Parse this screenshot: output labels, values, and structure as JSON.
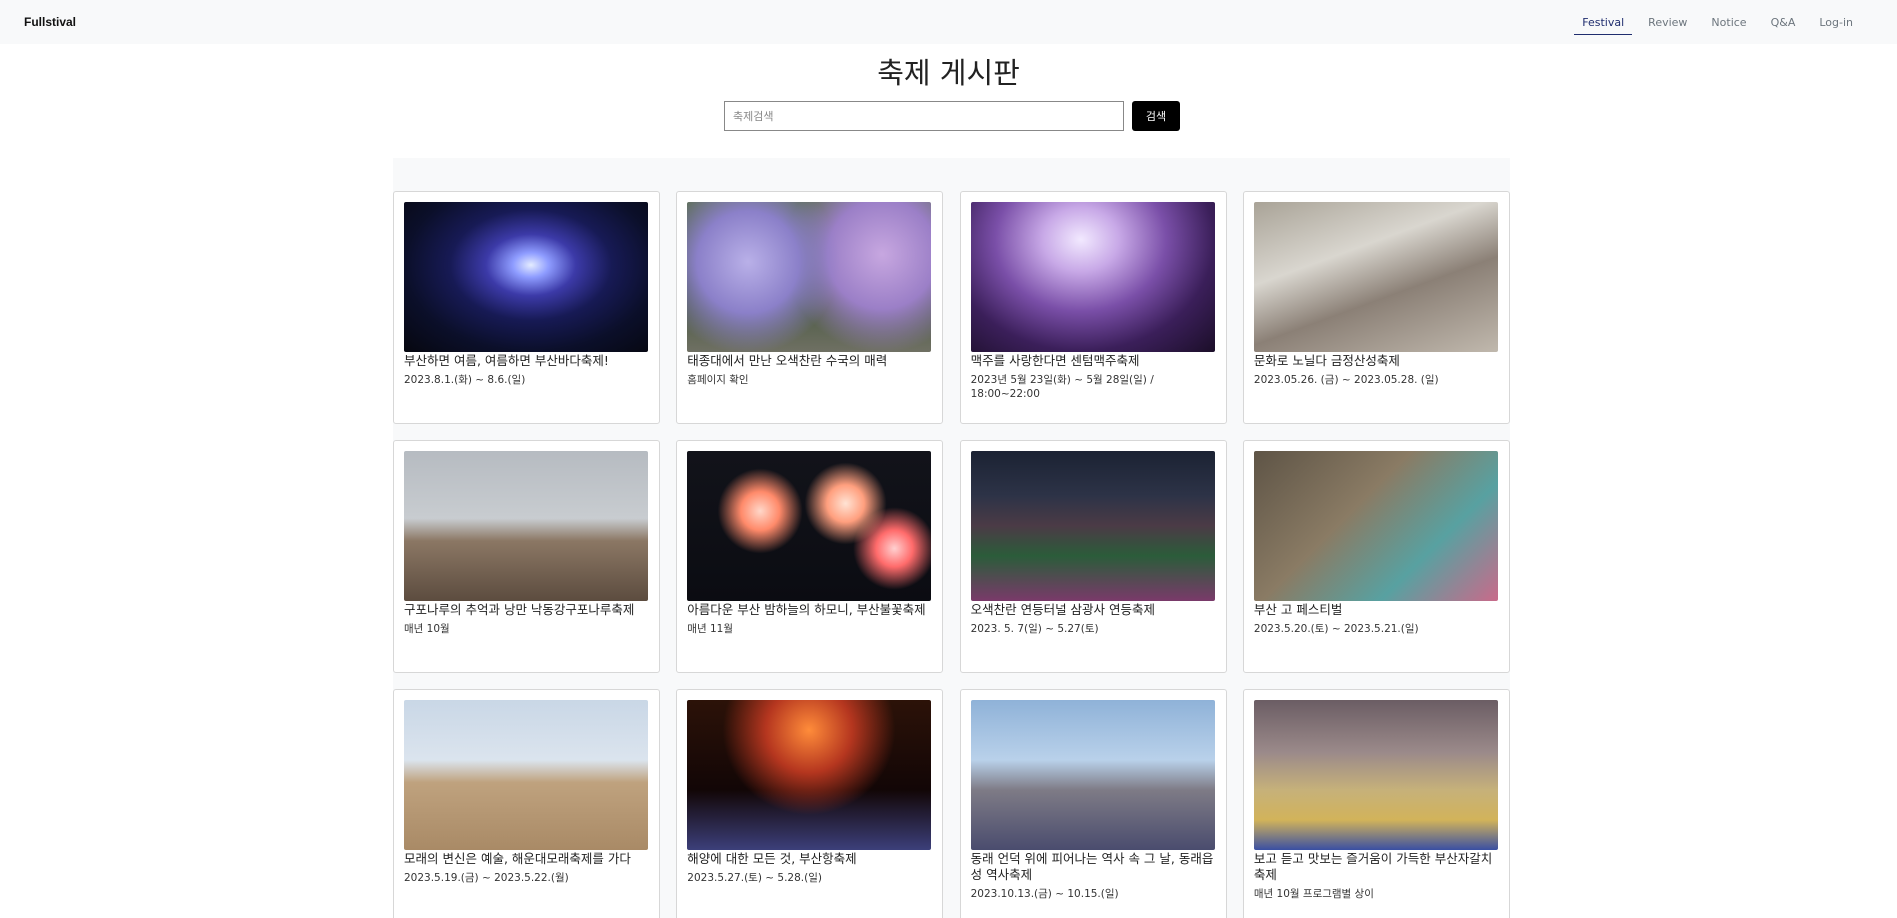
{
  "navbar": {
    "brand": "Fullstival",
    "links": [
      {
        "label": "Festival",
        "active": true
      },
      {
        "label": "Review",
        "active": false
      },
      {
        "label": "Notice",
        "active": false
      },
      {
        "label": "Q&A",
        "active": false
      },
      {
        "label": "Log-in",
        "active": false
      }
    ]
  },
  "page": {
    "title": "축제 게시판"
  },
  "search": {
    "placeholder": "축제검색",
    "button_label": "검색"
  },
  "festivals": [
    {
      "title": "부산하면 여름, 여름하면 부산바다축제!",
      "date": "2023.8.1.(화) ~ 8.6.(일)"
    },
    {
      "title": "태종대에서 만난 오색찬란 수국의 매력",
      "date": "홈페이지 확인"
    },
    {
      "title": "맥주를 사랑한다면 센텀맥주축제",
      "date": "2023년 5월 23일(화) ~ 5월 28일(일) / 18:00~22:00"
    },
    {
      "title": "문화로 노닐다 금정산성축제",
      "date": "2023.05.26. (금) ~ 2023.05.28. (일)"
    },
    {
      "title": "구포나루의 추억과 낭만 낙동강구포나루축제",
      "date": "매년 10월"
    },
    {
      "title": "아름다운 부산 밤하늘의 하모니, 부산불꽃축제",
      "date": "매년 11월"
    },
    {
      "title": "오색찬란 연등터널 삼광사 연등축제",
      "date": "2023. 5. 7(일) ~ 5.27(토)"
    },
    {
      "title": "부산 고 페스티벌",
      "date": "2023.5.20.(토) ~ 2023.5.21.(일)"
    },
    {
      "title": "모래의 변신은 예술, 해운대모래축제를 가다",
      "date": "2023.5.19.(금) ~ 2023.5.22.(월)"
    },
    {
      "title": "해양에 대한 모든 것, 부산항축제",
      "date": "2023.5.27.(토) ~ 5.28.(일)"
    },
    {
      "title": "동래 언덕 위에 피어나는 역사 속 그 날, 동래읍성 역사축제",
      "date": "2023.10.13.(금) ~ 10.15.(일)"
    },
    {
      "title": "보고 듣고 맛보는 즐거움이 가득한 부산자갈치축제",
      "date": "매년 10월 프로그램별 상이"
    }
  ]
}
